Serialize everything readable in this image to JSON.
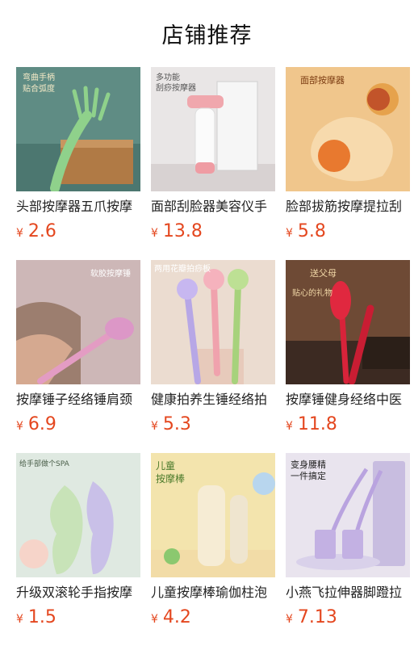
{
  "page_title": "店铺推荐",
  "currency_symbol": "¥",
  "products": [
    {
      "name": "头部按摩器五爪按摩",
      "price": "2.6",
      "overlay": [
        "弯曲手柄",
        "贴合弧度"
      ]
    },
    {
      "name": "面部刮脸器美容仪手",
      "price": "13.8",
      "overlay": [
        "多功能",
        "刮痧按摩器"
      ]
    },
    {
      "name": "脸部拔筋按摩提拉刮",
      "price": "5.8",
      "overlay": [
        "面部按摩器"
      ]
    },
    {
      "name": "按摩锤子经络锤肩颈",
      "price": "6.9",
      "overlay": [
        "软胶按摩锤"
      ]
    },
    {
      "name": "健康拍养生锤经络拍",
      "price": "5.3",
      "overlay": [
        "两用花瓣拍痧板"
      ]
    },
    {
      "name": "按摩锤健身经络中医",
      "price": "11.8",
      "overlay": [
        "送父母",
        "贴心的礼物"
      ]
    },
    {
      "name": "升级双滚轮手指按摩",
      "price": "1.5",
      "overlay": [
        "给手部做个SPA"
      ]
    },
    {
      "name": "儿童按摩棒瑜伽柱泡",
      "price": "4.2",
      "overlay": [
        "儿童",
        "按摩棒"
      ]
    },
    {
      "name": "小燕飞拉伸器脚蹬拉",
      "price": "7.13",
      "overlay": [
        "变身腰精",
        "一件搞定"
      ]
    }
  ]
}
